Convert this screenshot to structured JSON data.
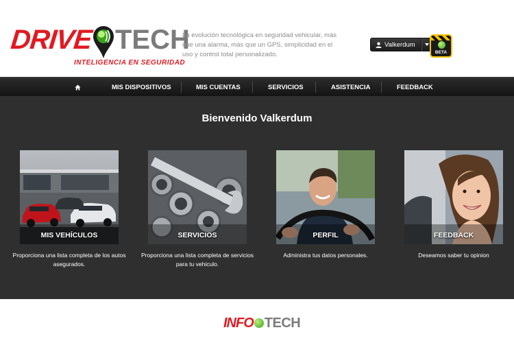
{
  "header": {
    "logo": {
      "word1": "DRIVE",
      "word2": "TECH",
      "tag": "INTELIGENCIA EN SEGURIDAD"
    },
    "tagline": "La evolución tecnológica en seguridad vehicular, más que una alarma, más que un GPS, simplicidad en el uso y control total personalizado.",
    "user_label": "Valkerdum",
    "beta_label": "BETA"
  },
  "nav": {
    "items": [
      "MIS DISPOSITIVOS",
      "MIS CUENTAS",
      "SERVICIOS",
      "ASISTENCIA",
      "FEEDBACK"
    ]
  },
  "main": {
    "welcome": "Bienvenido Valkerdum",
    "cards": [
      {
        "label": "MIS VEHÍCULOS",
        "desc": "Proporciona una lista completa de los autos asegurados."
      },
      {
        "label": "SERVICIOS",
        "desc": "Proporciona una lista completa de servicios para tu vehiculo."
      },
      {
        "label": "PERFIL",
        "desc": "Administra tus datos personales."
      },
      {
        "label": "FEEDBACK",
        "desc": "Deseamos saber tu opinion"
      }
    ]
  },
  "footer": {
    "logo": {
      "word1": "INFO",
      "word2": "TECH"
    }
  },
  "colors": {
    "brand_red": "#e11a22",
    "brand_gray": "#7b7b7b",
    "dark_bg": "#2f2f2f",
    "accent_green": "#3aa21a"
  },
  "icons": {
    "home": "home-icon",
    "user": "user-icon",
    "caret": "caret-down-icon"
  }
}
